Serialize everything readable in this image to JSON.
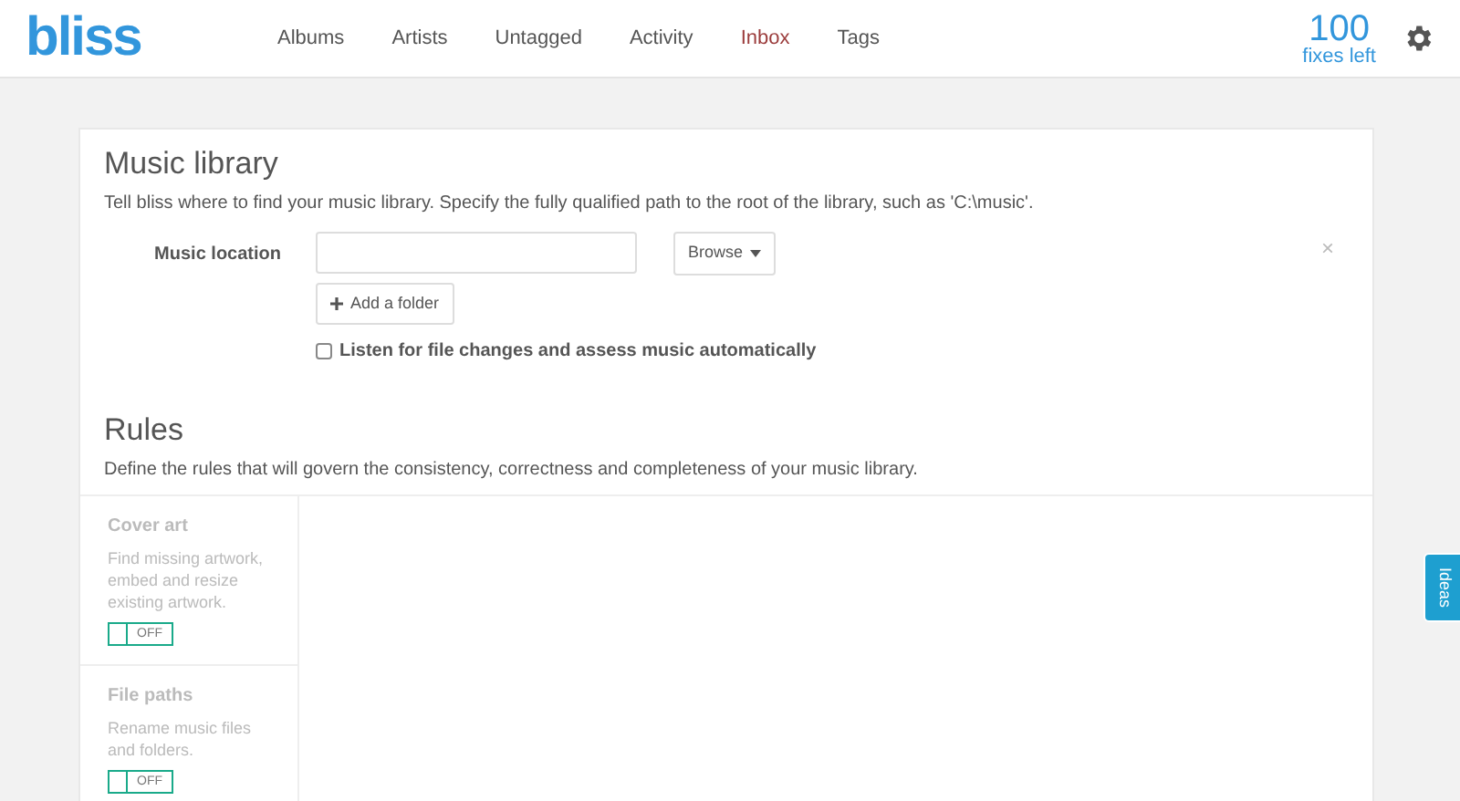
{
  "brand": "bliss",
  "nav": [
    {
      "label": "Albums",
      "selected": false
    },
    {
      "label": "Artists",
      "selected": false
    },
    {
      "label": "Untagged",
      "selected": false
    },
    {
      "label": "Activity",
      "selected": false
    },
    {
      "label": "Inbox",
      "selected": true
    },
    {
      "label": "Tags",
      "selected": false
    }
  ],
  "fixes": {
    "count": "100",
    "label": "fixes left"
  },
  "library": {
    "title": "Music library",
    "description": "Tell bliss where to find your music library. Specify the fully qualified path to the root of the library, such as 'C:\\music'.",
    "field_label": "Music location",
    "browse": "Browse",
    "add_folder": "Add a folder",
    "listen": {
      "label": "Listen for file changes and assess music automatically",
      "checked": false
    },
    "close": "×"
  },
  "rules": {
    "title": "Rules",
    "description": "Define the rules that will govern the consistency, correctness and completeness of your music library.",
    "items": [
      {
        "title": "Cover art",
        "description": "Find missing artwork, embed and resize existing artwork.",
        "toggle": {
          "on": false,
          "label": "OFF"
        }
      },
      {
        "title": "File paths",
        "description": "Rename music files and folders.",
        "toggle": {
          "on": false,
          "label": "OFF"
        }
      }
    ]
  },
  "ideas_tab": "Ideas"
}
